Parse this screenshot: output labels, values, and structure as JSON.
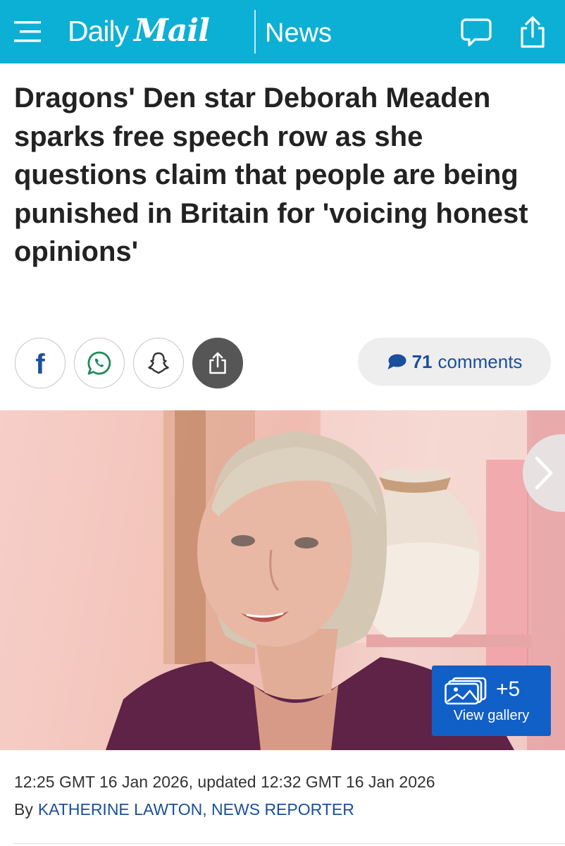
{
  "header": {
    "logo_daily": "Daily",
    "logo_mail": "Mail",
    "section": "News",
    "menu_icon": "hamburger-menu-icon",
    "comments_icon": "speech-bubble-icon",
    "share_icon": "share-icon",
    "background_color": "#0cb0d4"
  },
  "article": {
    "headline": "Dragons' Den star Deborah Meaden sparks free speech row as she questions claim that people are being punished in Britain for 'voicing honest opinions'",
    "timestamp": "12:25 GMT 16 Jan 2026, updated 12:32 GMT 16 Jan 2026",
    "byline_prefix": "By",
    "author": "KATHERINE LAWTON, NEWS REPORTER"
  },
  "share_bar": {
    "buttons": [
      {
        "icon": "facebook-icon",
        "label": "f"
      },
      {
        "icon": "whatsapp-icon"
      },
      {
        "icon": "snapchat-icon"
      },
      {
        "icon": "share-icon"
      }
    ],
    "comments_count": "71",
    "comments_label": "comments",
    "accent_color": "#1a4f9c"
  },
  "gallery": {
    "extra_count": "+5",
    "label": "View gallery",
    "next_icon": "chevron-right-icon",
    "gallery_icon": "image-stack-icon",
    "button_color": "#1160c8"
  }
}
